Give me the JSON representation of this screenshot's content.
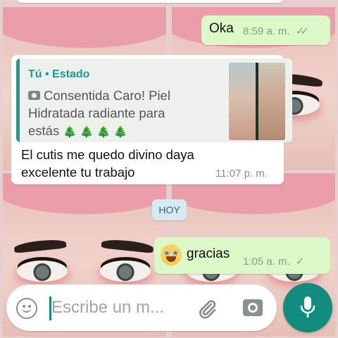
{
  "colors": {
    "outgoing_bubble": "#dcf8c6",
    "incoming_bubble": "#ffffff",
    "accent": "#1a9c8c",
    "mic_button": "#128c7e",
    "day_chip": "#d5eaf2"
  },
  "messages": [
    {
      "direction": "outgoing",
      "text": "Oka",
      "time": "8:59 a. m.",
      "status": "read",
      "status_icon": "double-check-icon"
    },
    {
      "direction": "incoming",
      "reply_to": {
        "author": "Tú • Estado",
        "media_icon": "camera-icon",
        "preview_lines": [
          "Consentida Caro! Piel",
          "Hidratada radiante para",
          "estás"
        ],
        "preview_emoji": [
          "🎄",
          "🎄",
          "🎄",
          "🎄"
        ],
        "thumbnail": "status-photo-thumbnail"
      },
      "lines": [
        "El cutis me quedo divino daya",
        "excelente tu trabajo"
      ],
      "time": "11:07 p. m."
    },
    {
      "type": "day_separator",
      "text": "HOY"
    },
    {
      "direction": "outgoing",
      "emoji": "star-struck-emoji",
      "text": "gracias",
      "time": "1:05 a. m.",
      "status": "sent",
      "status_icon": "single-check-icon"
    }
  ],
  "composer": {
    "placeholder": "Escribe un m...",
    "value": "",
    "emoji_icon": "smiley-icon",
    "attach_icon": "paperclip-icon",
    "camera_icon": "camera-icon",
    "mic_icon": "microphone-icon"
  }
}
